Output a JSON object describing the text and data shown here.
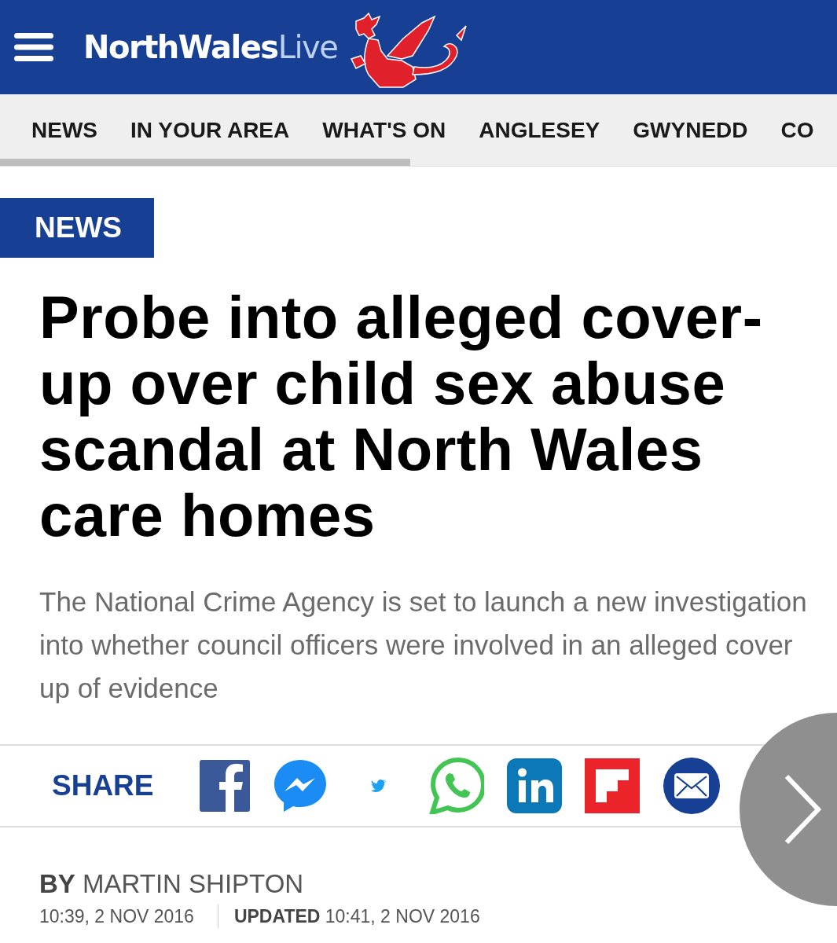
{
  "header": {
    "logo": "**NorthWales**Live"
  },
  "nav": {
    "items": [
      "NEWS",
      "IN YOUR AREA",
      "WHAT'S ON",
      "ANGLESEY",
      "GWYNEDD",
      "CO"
    ]
  },
  "article": {
    "section": "NEWS",
    "headline": "Probe into alleged cover-up over child sex abuse scandal at North Wales care homes",
    "standfirst": "The National Crime Agency is set to launch a new investigation into whether council officers were involved in an alleged cover up of evidence",
    "share": {
      "label": "SHARE",
      "buttons": [
        {
          "kind": "facebook"
        },
        {
          "kind": "messenger"
        },
        {
          "kind": "twitter"
        },
        {
          "kind": "whatsapp"
        },
        {
          "kind": "linkedin"
        },
        {
          "kind": "flipboard"
        },
        {
          "kind": "email"
        }
      ]
    },
    "byline": "**BY** MARTIN SHIPTON",
    "published": "10:39, 2 NOV 2016",
    "updated": "**UPDATED** 10:41, 2 NOV 2016"
  }
}
